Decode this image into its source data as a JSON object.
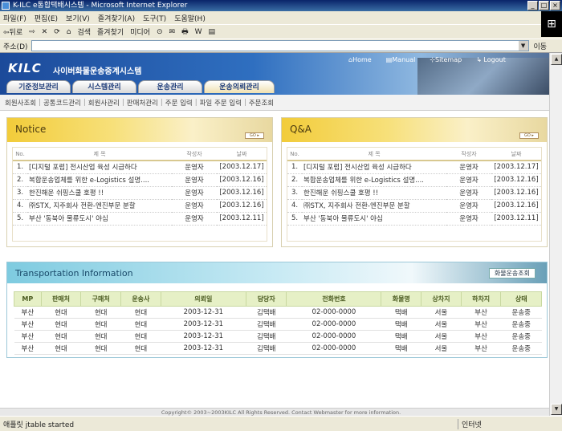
{
  "window": {
    "title": "K-ILC e통합택배시스템 - Microsoft Internet Explorer",
    "min": "_",
    "max": "□",
    "close": "×"
  },
  "menu": [
    "파일(F)",
    "편집(E)",
    "보기(V)",
    "즐겨찾기(A)",
    "도구(T)",
    "도움말(H)"
  ],
  "toolbar": [
    "⇦뒤로",
    "⇨",
    "✕",
    "⟳",
    "⌂",
    "검색",
    "즐겨찾기",
    "미디어",
    "⊙",
    "✉",
    "🖶",
    "W",
    "▤"
  ],
  "address": {
    "label": "주소(D)",
    "go": "이동",
    "dd": "▼"
  },
  "header": {
    "logo": "KILC",
    "site_name": "사이버화물운송중계시스템",
    "links": [
      "⌂Home",
      "▤Manual",
      "⊹Sitemap",
      "↳ Logout"
    ]
  },
  "tabs": [
    "기준정보관리",
    "시스템관리",
    "운송관리",
    "운송의뢰관리"
  ],
  "subnav": [
    "회원사조회",
    "공통코드관리",
    "회원사관리",
    "판매처관리",
    "주문 입력",
    "파일 주문 입력",
    "주문조회"
  ],
  "notice": {
    "title": "Notice",
    "go": "GO ▸",
    "cols": [
      "No.",
      "제 목",
      "작성자",
      "날짜"
    ],
    "rows": [
      [
        "1.",
        "[디지털 포럼] 전시산업 육성 시급하다",
        "운영자",
        "[2003.12.17]"
      ],
      [
        "2.",
        "복합운송업체를 위한 e-Logistics 설명....",
        "운영자",
        "[2003.12.16]"
      ],
      [
        "3.",
        "한진해운 쉬핑스쿨 호평 !!",
        "운영자",
        "[2003.12.16]"
      ],
      [
        "4.",
        "㈜STX, 지주회사 전환-엔진부문 분할",
        "운영자",
        "[2003.12.16]"
      ],
      [
        "5.",
        "부산 '동북아 물류도시' 야심",
        "운영자",
        "[2003.12.11]"
      ]
    ]
  },
  "qa": {
    "title": "Q&A",
    "go": "GO ▸",
    "cols": [
      "No.",
      "제 목",
      "작성자",
      "날짜"
    ],
    "rows": [
      [
        "1.",
        "[디지털 포럼] 전시산업 육성 시급하다",
        "운영자",
        "[2003.12.17]"
      ],
      [
        "2.",
        "복합운송업체를 위한 e-Logistics 설명....",
        "운영자",
        "[2003.12.16]"
      ],
      [
        "3.",
        "한진해운 쉬핑스쿨 호평 !!",
        "운영자",
        "[2003.12.16]"
      ],
      [
        "4.",
        "㈜STX, 지주회사 전환-엔진부문 분할",
        "운영자",
        "[2003.12.16]"
      ],
      [
        "5.",
        "부산 '동북아 물류도시' 야심",
        "운영자",
        "[2003.12.11]"
      ]
    ]
  },
  "transport": {
    "title": "Transportation Information",
    "button": "화물운송조회",
    "cols": [
      "MP",
      "판매처",
      "구매처",
      "운송사",
      "의뢰일",
      "담당자",
      "전화번호",
      "화물명",
      "상차지",
      "하차지",
      "상태"
    ],
    "rows": [
      [
        "부산",
        "현대",
        "현대",
        "현대",
        "2003-12-31",
        "김택배",
        "02-000-0000",
        "택배",
        "서울",
        "부산",
        "운송중"
      ],
      [
        "부산",
        "현대",
        "현대",
        "현대",
        "2003-12-31",
        "김택배",
        "02-000-0000",
        "택배",
        "서울",
        "부산",
        "운송중"
      ],
      [
        "부산",
        "현대",
        "현대",
        "현대",
        "2003-12-31",
        "김택배",
        "02-000-0000",
        "택배",
        "서울",
        "부산",
        "운송중"
      ],
      [
        "부산",
        "현대",
        "현대",
        "현대",
        "2003-12-31",
        "김택배",
        "02-000-0000",
        "택배",
        "서울",
        "부산",
        "운송중"
      ]
    ]
  },
  "footer": "Copyright© 2003~2003KILC All Rights Reserved. Contact Webmaster for more information.",
  "status": {
    "left": "애플릿 jtable started",
    "right": "인터넷"
  },
  "scroll": {
    "up": "▲",
    "down": "▼"
  }
}
